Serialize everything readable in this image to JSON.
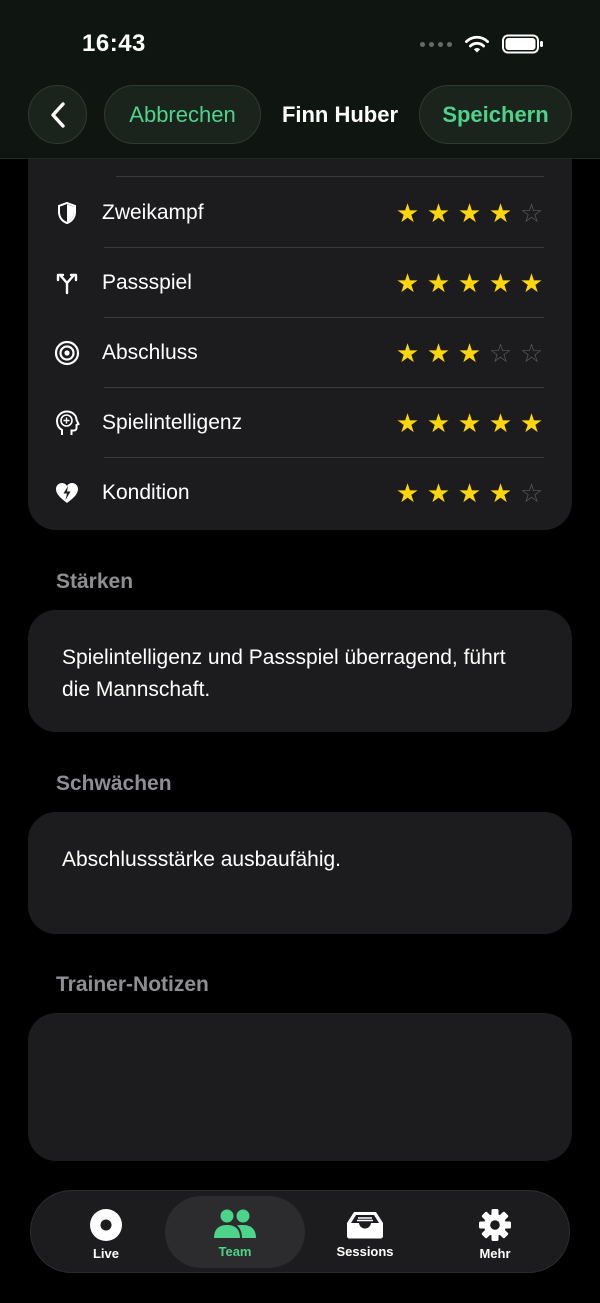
{
  "status": {
    "time": "16:43"
  },
  "nav": {
    "cancel_label": "Abbrechen",
    "title": "Finn Huber",
    "save_label": "Speichern"
  },
  "ratings": [
    {
      "label": "Zweikampf",
      "icon": "shield-icon",
      "stars": 4,
      "max": 5
    },
    {
      "label": "Passspiel",
      "icon": "pass-icon",
      "stars": 5,
      "max": 5
    },
    {
      "label": "Abschluss",
      "icon": "target-icon",
      "stars": 3,
      "max": 5
    },
    {
      "label": "Spielintelligenz",
      "icon": "brain-head-icon",
      "stars": 5,
      "max": 5
    },
    {
      "label": "Kondition",
      "icon": "heart-bolt-icon",
      "stars": 4,
      "max": 5
    }
  ],
  "strengths": {
    "label": "Stärken",
    "text": "Spielintelligenz und Passspiel überragend, führt die Mannschaft."
  },
  "weaknesses": {
    "label": "Schwächen",
    "text": "Abschlussstärke ausbaufähig."
  },
  "notes": {
    "label": "Trainer-Notizen",
    "text": ""
  },
  "tabs": [
    {
      "label": "Live",
      "icon": "record-icon",
      "active": false
    },
    {
      "label": "Team",
      "icon": "people-icon",
      "active": true
    },
    {
      "label": "Sessions",
      "icon": "tray-icon",
      "active": false
    },
    {
      "label": "Mehr",
      "icon": "gear-icon",
      "active": false
    }
  ],
  "colors": {
    "accent": "#4ed38a",
    "star": "#ffd60a",
    "card": "#1c1c1e"
  }
}
